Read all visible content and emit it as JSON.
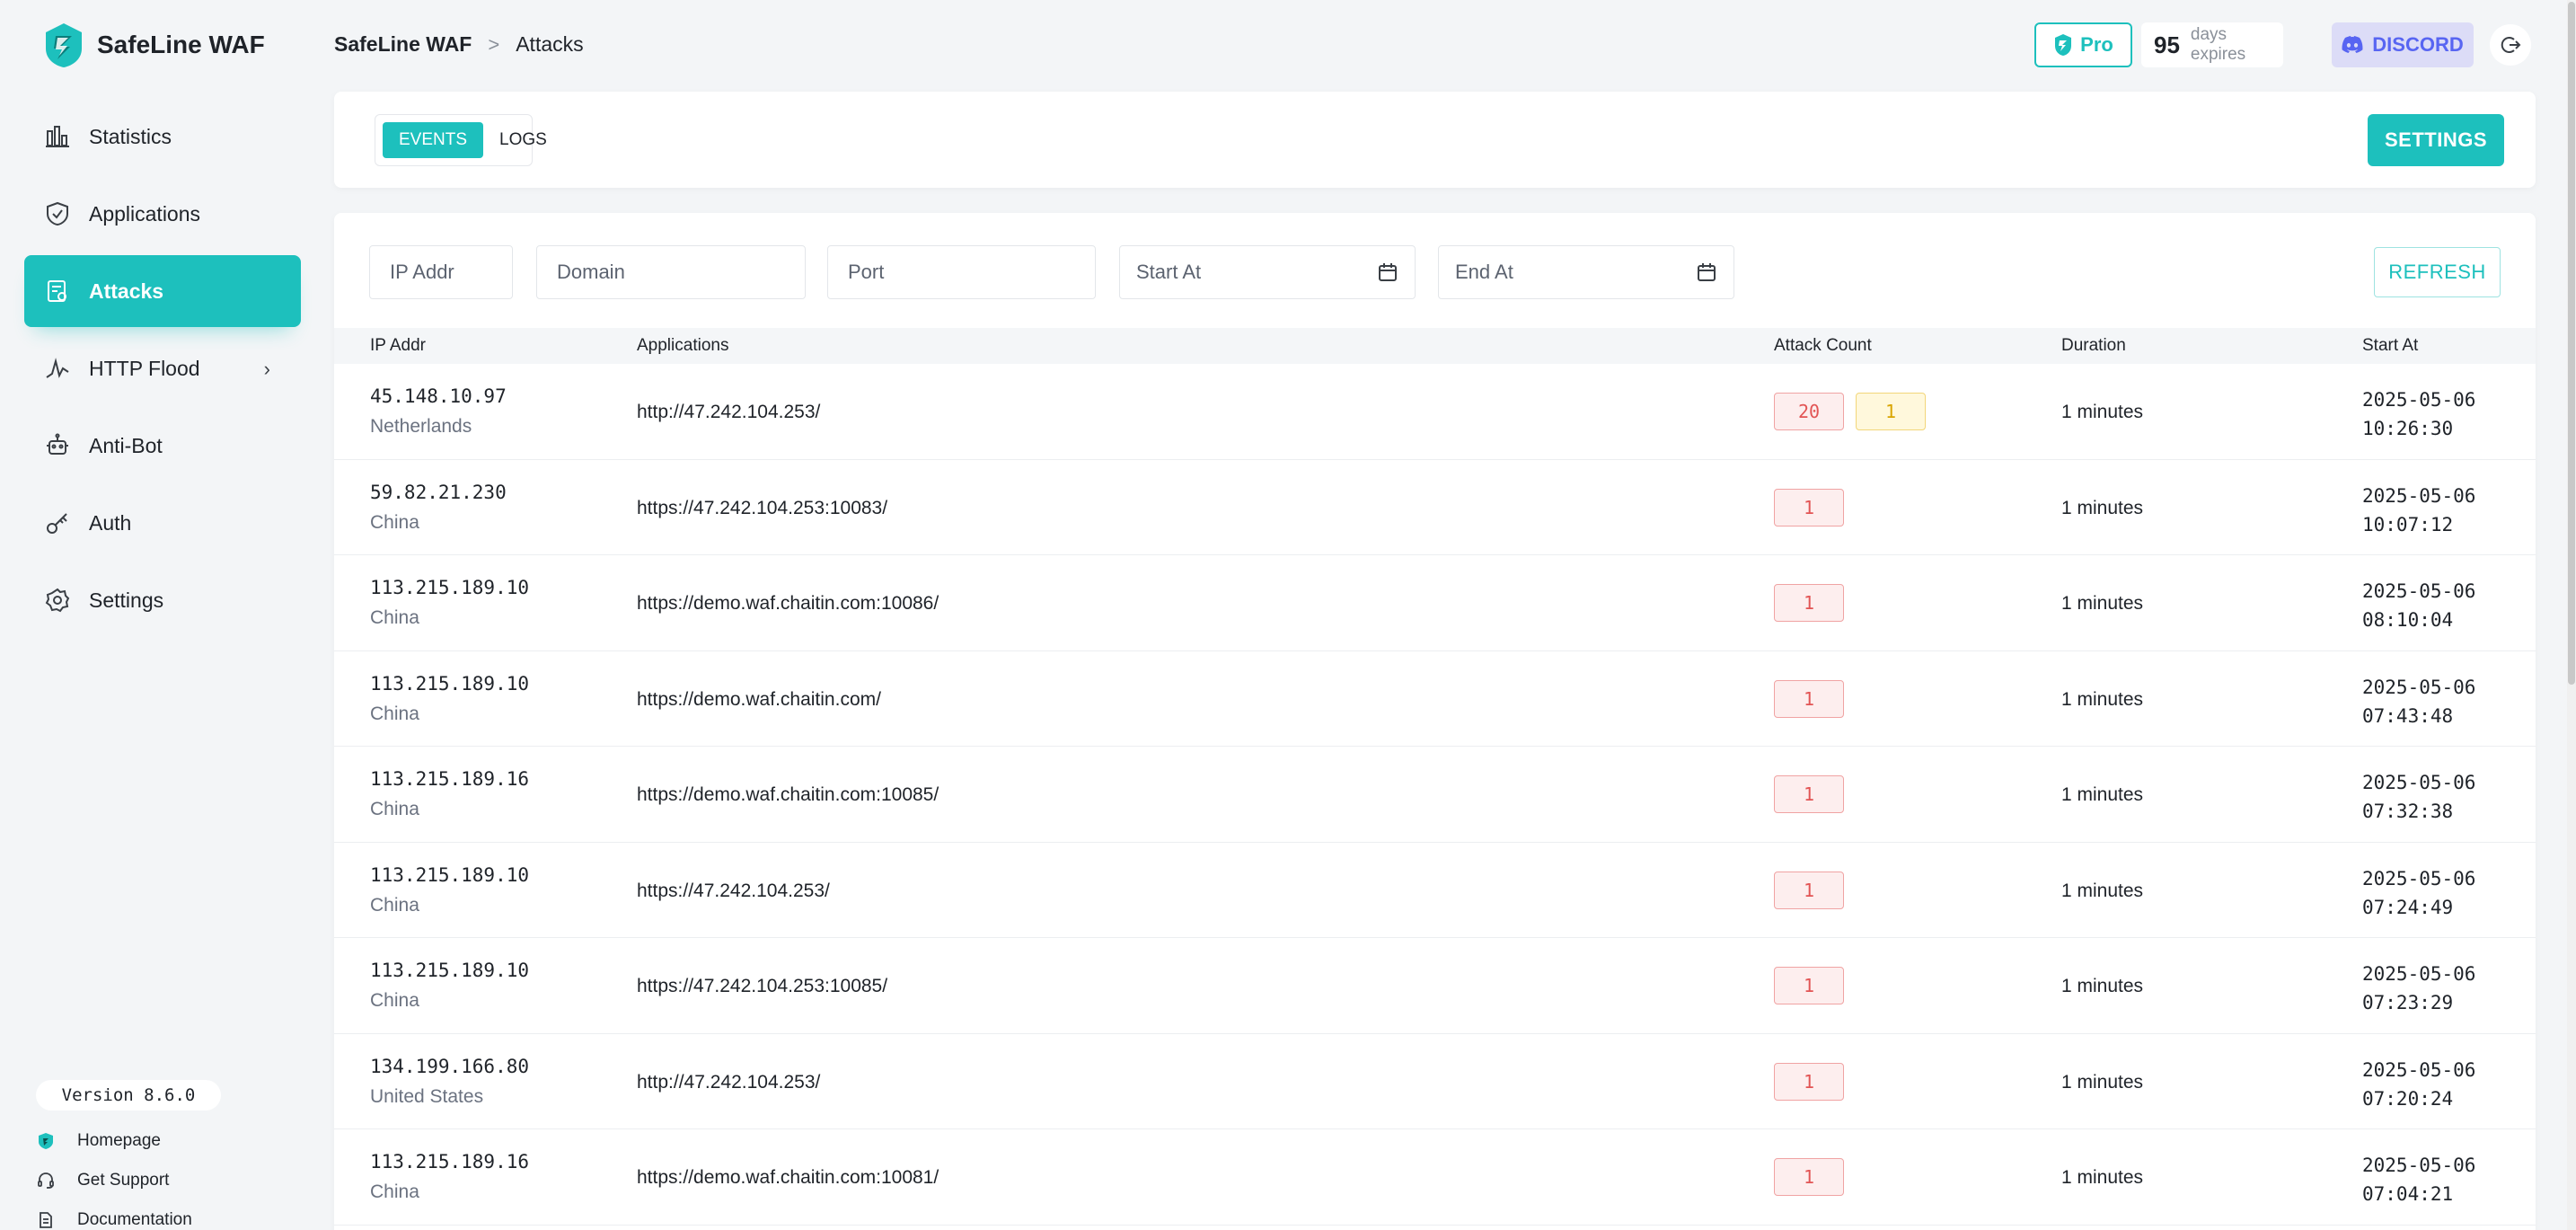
{
  "app": {
    "name": "SafeLine WAF",
    "version": "Version 8.6.0"
  },
  "sidebar": {
    "items": [
      {
        "label": "Statistics",
        "icon": "bar-chart-icon",
        "active": false
      },
      {
        "label": "Applications",
        "icon": "shield-icon",
        "active": false
      },
      {
        "label": "Attacks",
        "icon": "attack-doc-icon",
        "active": true
      },
      {
        "label": "HTTP Flood",
        "icon": "flood-wave-icon",
        "active": false,
        "has_submenu": true
      },
      {
        "label": "Anti-Bot",
        "icon": "robot-icon",
        "active": false
      },
      {
        "label": "Auth",
        "icon": "key-icon",
        "active": false
      },
      {
        "label": "Settings",
        "icon": "gear-icon",
        "active": false
      }
    ],
    "footer_links": [
      {
        "label": "Homepage",
        "icon": "logo-shield-icon"
      },
      {
        "label": "Get Support",
        "icon": "headset-icon"
      },
      {
        "label": "Documentation",
        "icon": "document-icon"
      }
    ]
  },
  "header": {
    "breadcrumb_root": "SafeLine WAF",
    "breadcrumb_sep": ">",
    "breadcrumb_current": "Attacks",
    "pro_label": "Pro",
    "days_count": "95",
    "days_label": "days expires",
    "discord_label": "DISCORD"
  },
  "tabs": {
    "events": "EVENTS",
    "logs": "LOGS",
    "active": "events",
    "settings_label": "SETTINGS"
  },
  "filters": {
    "ip_placeholder": "IP Addr",
    "domain_placeholder": "Domain",
    "port_placeholder": "Port",
    "start_placeholder": "Start At",
    "end_placeholder": "End At",
    "refresh_label": "REFRESH"
  },
  "table": {
    "columns": {
      "ip": "IP Addr",
      "applications": "Applications",
      "attack_count": "Attack Count",
      "duration": "Duration",
      "start_at": "Start At"
    },
    "rows": [
      {
        "ip": "45.148.10.97",
        "country": "Netherlands",
        "app": "http://47.242.104.253/",
        "counts": [
          {
            "value": "20",
            "color": "red"
          },
          {
            "value": "1",
            "color": "yellow"
          }
        ],
        "duration": "1 minutes",
        "date": "2025-05-06",
        "time": "10:26:30"
      },
      {
        "ip": "59.82.21.230",
        "country": "China",
        "app": "https://47.242.104.253:10083/",
        "counts": [
          {
            "value": "1",
            "color": "red"
          }
        ],
        "duration": "1 minutes",
        "date": "2025-05-06",
        "time": "10:07:12"
      },
      {
        "ip": "113.215.189.10",
        "country": "China",
        "app": "https://demo.waf.chaitin.com:10086/",
        "counts": [
          {
            "value": "1",
            "color": "red"
          }
        ],
        "duration": "1 minutes",
        "date": "2025-05-06",
        "time": "08:10:04"
      },
      {
        "ip": "113.215.189.10",
        "country": "China",
        "app": "https://demo.waf.chaitin.com/",
        "counts": [
          {
            "value": "1",
            "color": "red"
          }
        ],
        "duration": "1 minutes",
        "date": "2025-05-06",
        "time": "07:43:48"
      },
      {
        "ip": "113.215.189.16",
        "country": "China",
        "app": "https://demo.waf.chaitin.com:10085/",
        "counts": [
          {
            "value": "1",
            "color": "red"
          }
        ],
        "duration": "1 minutes",
        "date": "2025-05-06",
        "time": "07:32:38"
      },
      {
        "ip": "113.215.189.10",
        "country": "China",
        "app": "https://47.242.104.253/",
        "counts": [
          {
            "value": "1",
            "color": "red"
          }
        ],
        "duration": "1 minutes",
        "date": "2025-05-06",
        "time": "07:24:49"
      },
      {
        "ip": "113.215.189.10",
        "country": "China",
        "app": "https://47.242.104.253:10085/",
        "counts": [
          {
            "value": "1",
            "color": "red"
          }
        ],
        "duration": "1 minutes",
        "date": "2025-05-06",
        "time": "07:23:29"
      },
      {
        "ip": "134.199.166.80",
        "country": "United States",
        "app": "http://47.242.104.253/",
        "counts": [
          {
            "value": "1",
            "color": "red"
          }
        ],
        "duration": "1 minutes",
        "date": "2025-05-06",
        "time": "07:20:24"
      },
      {
        "ip": "113.215.189.16",
        "country": "China",
        "app": "https://demo.waf.chaitin.com:10081/",
        "counts": [
          {
            "value": "1",
            "color": "red"
          }
        ],
        "duration": "1 minutes",
        "date": "2025-05-06",
        "time": "07:04:21"
      }
    ]
  },
  "colors": {
    "accent": "#1dc0bd",
    "danger": "#e25454",
    "warning": "#d9a400",
    "discord": "#5865f2"
  }
}
